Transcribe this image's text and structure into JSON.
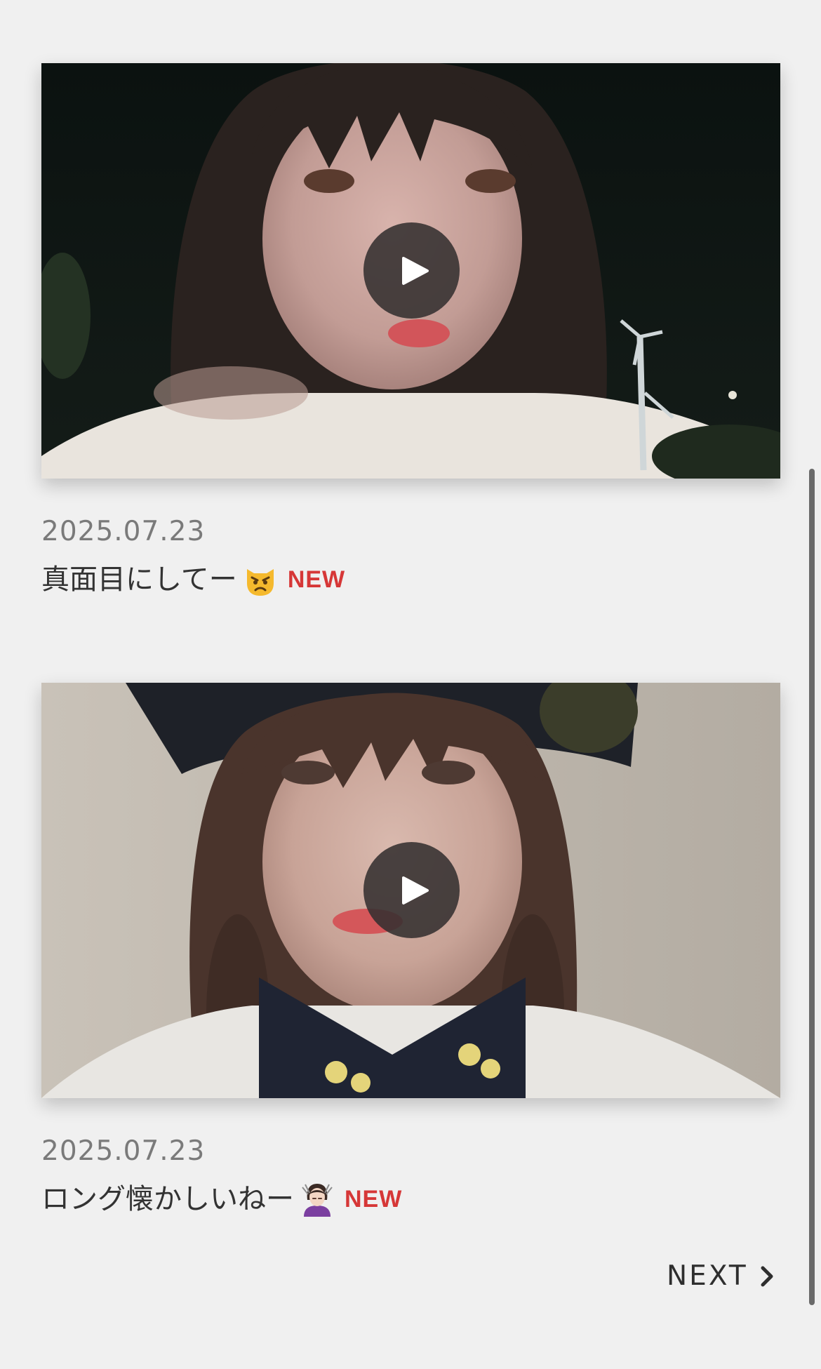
{
  "posts": [
    {
      "date": "2025.07.23",
      "title": "真面目にしてー",
      "emoji_icon": "pouting-cat-face-icon",
      "badge": "NEW",
      "thumbnail_icon": "video-thumbnail-night-selfie",
      "play_icon": "play-icon"
    },
    {
      "date": "2025.07.23",
      "title": "ロング懐かしいねー",
      "emoji_icon": "woman-getting-haircut-icon",
      "badge": "NEW",
      "thumbnail_icon": "video-thumbnail-indoor-selfie",
      "play_icon": "play-icon"
    }
  ],
  "pagination": {
    "next_label": "NEXT",
    "next_icon": "chevron-right-icon"
  },
  "colors": {
    "background": "#f0f0f0",
    "new_badge": "#d63737",
    "date_text": "#7a7a7a",
    "title_text": "#333333"
  }
}
